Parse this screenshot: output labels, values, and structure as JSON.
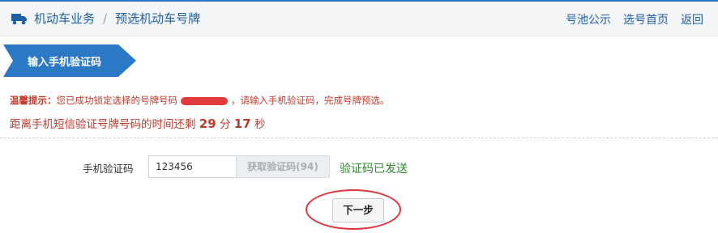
{
  "header": {
    "crumb_home": "机动车业务",
    "crumb_sep": "/",
    "crumb_current": "预选机动车号牌",
    "links": [
      "号池公示",
      "选号首页",
      "返回"
    ]
  },
  "step": {
    "label": "输入手机验证码"
  },
  "notice": {
    "title": "温馨提示：",
    "before_plate": "您已成功锁定选择的号牌号码",
    "after_plate": "，请输入手机验证码，完成号牌预选。"
  },
  "countdown": {
    "prefix": "距离手机短信验证号牌号码的时间还剩",
    "minutes": "29",
    "min_unit": "分",
    "seconds": "17",
    "sec_unit": "秒"
  },
  "form": {
    "code_label": "手机验证码",
    "code_value": "123456",
    "get_code_button": "获取验证码(94)",
    "sent_status": "验证码已发送"
  },
  "actions": {
    "next_button": "下一步"
  },
  "colors": {
    "accent": "#2b78c5",
    "warning_text": "#c0392b",
    "success_text": "#2e8b2e",
    "annotation_circle": "#e0343c"
  }
}
